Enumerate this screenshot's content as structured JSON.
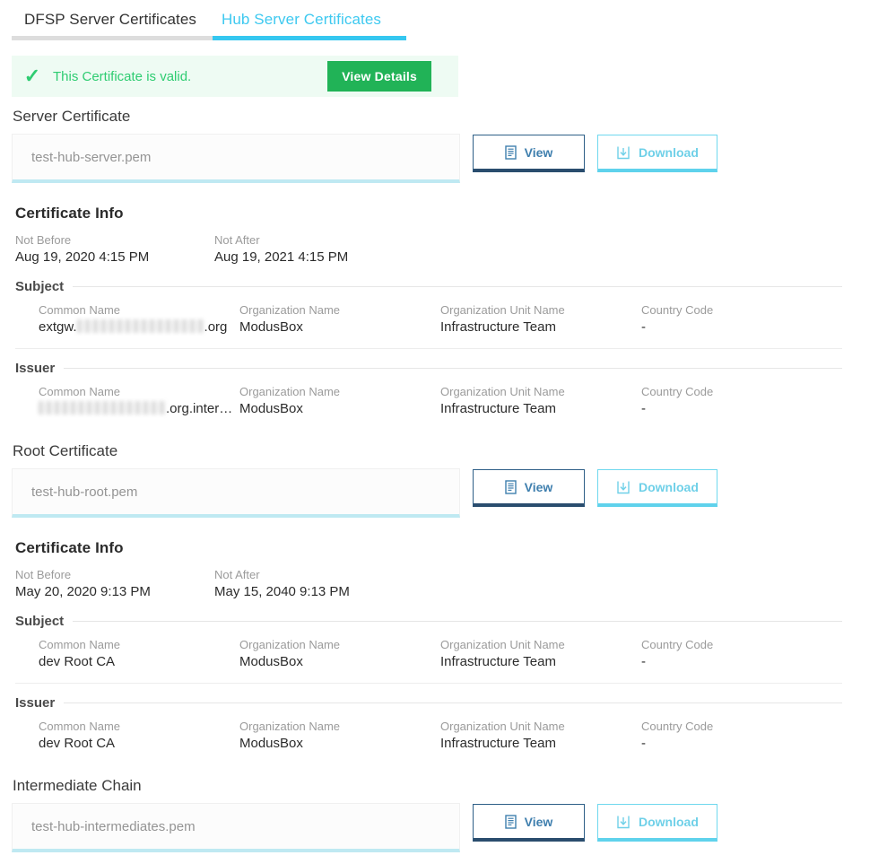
{
  "tabs": [
    {
      "label": "DFSP Server Certificates",
      "active": false
    },
    {
      "label": "Hub Server Certificates",
      "active": true
    }
  ],
  "banner": {
    "icon": "check-icon",
    "message": "This Certificate is valid.",
    "button_label": "View Details",
    "background_color": "#eefbf3",
    "text_color": "#2ecc71",
    "button_color": "#21b357"
  },
  "buttons": {
    "view_label": "View",
    "download_label": "Download",
    "view_icon": "document-icon",
    "download_icon": "download-icon",
    "view_color": "#3f7fae",
    "download_color": "#6fd0e8"
  },
  "field_labels": {
    "not_before": "Not Before",
    "not_after": "Not After",
    "common_name": "Common Name",
    "organization_name": "Organization Name",
    "organization_unit_name": "Organization Unit Name",
    "country_code": "Country Code"
  },
  "group_labels": {
    "subject": "Subject",
    "issuer": "Issuer"
  },
  "certificate_info_title": "Certificate Info",
  "sections": [
    {
      "title": "Server Certificate",
      "file_placeholder": "test-hub-server.pem",
      "info": {
        "not_before": "Aug 19, 2020 4:15 PM",
        "not_after": "Aug 19, 2021 4:15 PM",
        "subject": {
          "common_name_prefix": "extgw.",
          "common_name_redacted": true,
          "common_name_suffix": ".org",
          "organization_name": "ModusBox",
          "organization_unit_name": "Infrastructure Team",
          "country_code": "-"
        },
        "issuer": {
          "common_name_prefix": "",
          "common_name_redacted": true,
          "common_name_suffix": ".org.inter…",
          "organization_name": "ModusBox",
          "organization_unit_name": "Infrastructure Team",
          "country_code": "-"
        }
      }
    },
    {
      "title": "Root Certificate",
      "file_placeholder": "test-hub-root.pem",
      "info": {
        "not_before": "May 20, 2020 9:13 PM",
        "not_after": "May 15, 2040 9:13 PM",
        "subject": {
          "common_name_prefix": "dev Root CA",
          "common_name_redacted": false,
          "common_name_suffix": "",
          "organization_name": "ModusBox",
          "organization_unit_name": "Infrastructure Team",
          "country_code": "-"
        },
        "issuer": {
          "common_name_prefix": "dev Root CA",
          "common_name_redacted": false,
          "common_name_suffix": "",
          "organization_name": "ModusBox",
          "organization_unit_name": "Infrastructure Team",
          "country_code": "-"
        }
      }
    },
    {
      "title": "Intermediate Chain",
      "file_placeholder": "test-hub-intermediates.pem",
      "info": null
    }
  ]
}
